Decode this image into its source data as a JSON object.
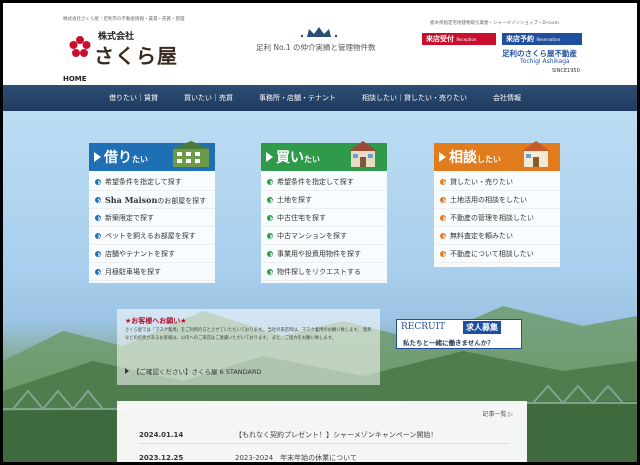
{
  "header": {
    "tagline": "株式会社さくら屋｜足利市の不動産情報・賃貸・売買・管理",
    "logo_company": "株式会社",
    "logo_name": "さくら屋",
    "slogan": "足利 No.1 の仲介実績と管理物件数",
    "right_small": "栃木県指定宅地建物取引業者・シャーメゾンショップ・D-room",
    "visit_button": "来店受付",
    "visit_button_sub": "Reception",
    "reserve_button": "来店予約",
    "reserve_button_sub": "Reservation",
    "brand_jp": "足利のさくら屋不動産",
    "brand_en": "Tochigi Ashikaga",
    "since": "SINCE1950",
    "home": "HOME"
  },
  "nav": {
    "items": [
      "借りたい｜賃貸",
      "買いたい｜売買",
      "事務所・店舗・テナント",
      "相談したい｜貸したい・売りたい",
      "会社情報"
    ]
  },
  "cards": {
    "rent": {
      "title": "借り",
      "title_small": "たい",
      "color": "#1f6fb5",
      "items": [
        "希望条件を指定して探す",
        "のお部屋を探す",
        "新築限定で探す",
        "ペットを飼えるお部屋を探す",
        "店舗やテナントを探す",
        "月極駐車場を探す"
      ],
      "shamaison_logo": "Sha Maison"
    },
    "buy": {
      "title": "買い",
      "title_small": "たい",
      "color": "#2e9a4a",
      "items": [
        "希望条件を指定して探す",
        "土地を探す",
        "中古住宅を探す",
        "中古マンションを探す",
        "事業用や投資用物件を探す",
        "物件探しをリクエストする"
      ]
    },
    "consult": {
      "title": "相談",
      "title_small": "したい",
      "color": "#e07b1e",
      "items": [
        "貸したい・売りたい",
        "土地活用の相談をしたい",
        "不動産の管理を相談したい",
        "無料査定を頼みたい",
        "不動産について相談したい"
      ]
    }
  },
  "notice": {
    "title": "★お客様へお願い★",
    "body": "さくら屋では「マスク着用」をご利用の方とさせていただいております。 当社の来店時は、マスク着用のお願い致します。 発熱などの症状があるお客様は、以内へのご来店はご遠慮いただいております。 また、ご協力をお願い致します。",
    "link": "【ご確認ください】さくら屋 6 STANDARD"
  },
  "recruit": {
    "en": "RECRUIT",
    "jp": "求人募集",
    "sub": "私たちと一緒に働きませんか？"
  },
  "news": {
    "more": "記事一覧 ▷",
    "items": [
      {
        "date": "2024.01.14",
        "text": "【もれなく契約プレゼント！】シャーメゾンキャンペーン開始！"
      },
      {
        "date": "2023.12.25",
        "text": "2023-2024　年末年始の休業について"
      }
    ]
  }
}
